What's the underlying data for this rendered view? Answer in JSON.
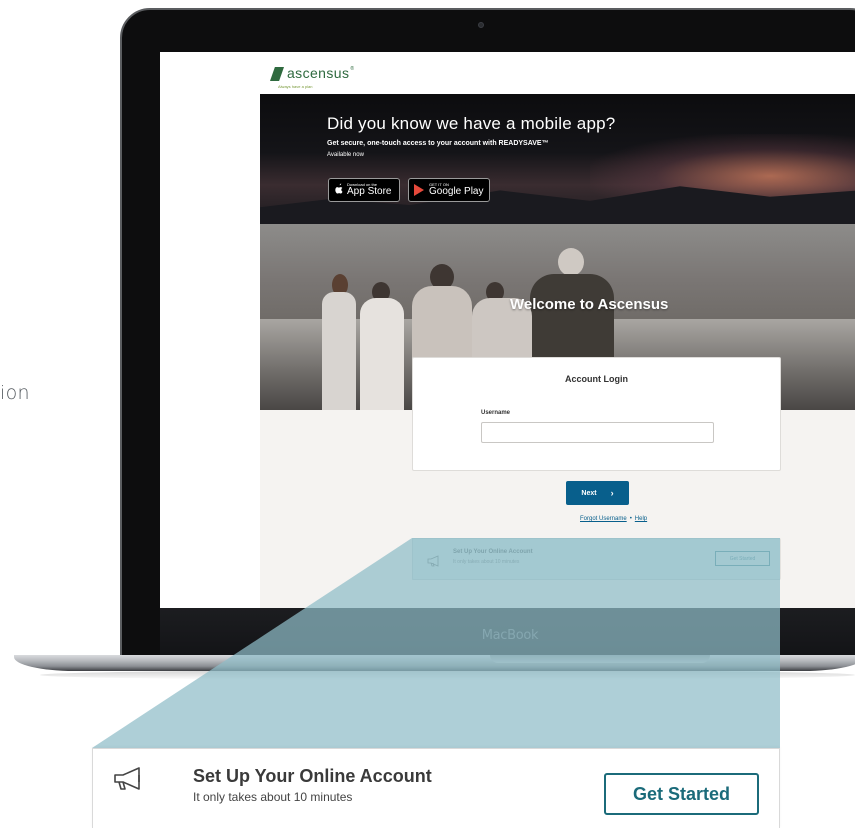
{
  "side_text": "ion",
  "laptop": {
    "brand_label": "MacBook"
  },
  "site": {
    "logo_text": "ascensus",
    "logo_mark": "®",
    "tagline": "Always have a plan"
  },
  "banner": {
    "title": "Did you know we have a mobile app?",
    "subtitle": "Get secure, one-touch access to your account with READYSAVE™",
    "availability": "Available now",
    "app_store": {
      "small": "Download on the",
      "big": "App Store",
      "icon": "apple-icon"
    },
    "google_play": {
      "small": "GET IT ON",
      "big": "Google Play",
      "icon": "google-play-icon"
    }
  },
  "hero": {
    "title": "Welcome to Ascensus"
  },
  "login": {
    "title": "Account Login",
    "username_label": "Username",
    "username_value": "",
    "username_placeholder": "",
    "next_label": "Next",
    "next_chevron": "›",
    "forgot_username": "Forgot Username",
    "separator": "•",
    "help": "Help"
  },
  "setup_card": {
    "title": "Set Up Your Online Account",
    "subtitle": "It only takes about 10 minutes",
    "button": "Get Started",
    "icon": "megaphone-icon"
  },
  "colors": {
    "brand_green": "#2f6a3f",
    "primary_blue": "#085f8c",
    "teal_accent": "#1b6b7a",
    "zoom_overlay": "#8fbcc7"
  }
}
